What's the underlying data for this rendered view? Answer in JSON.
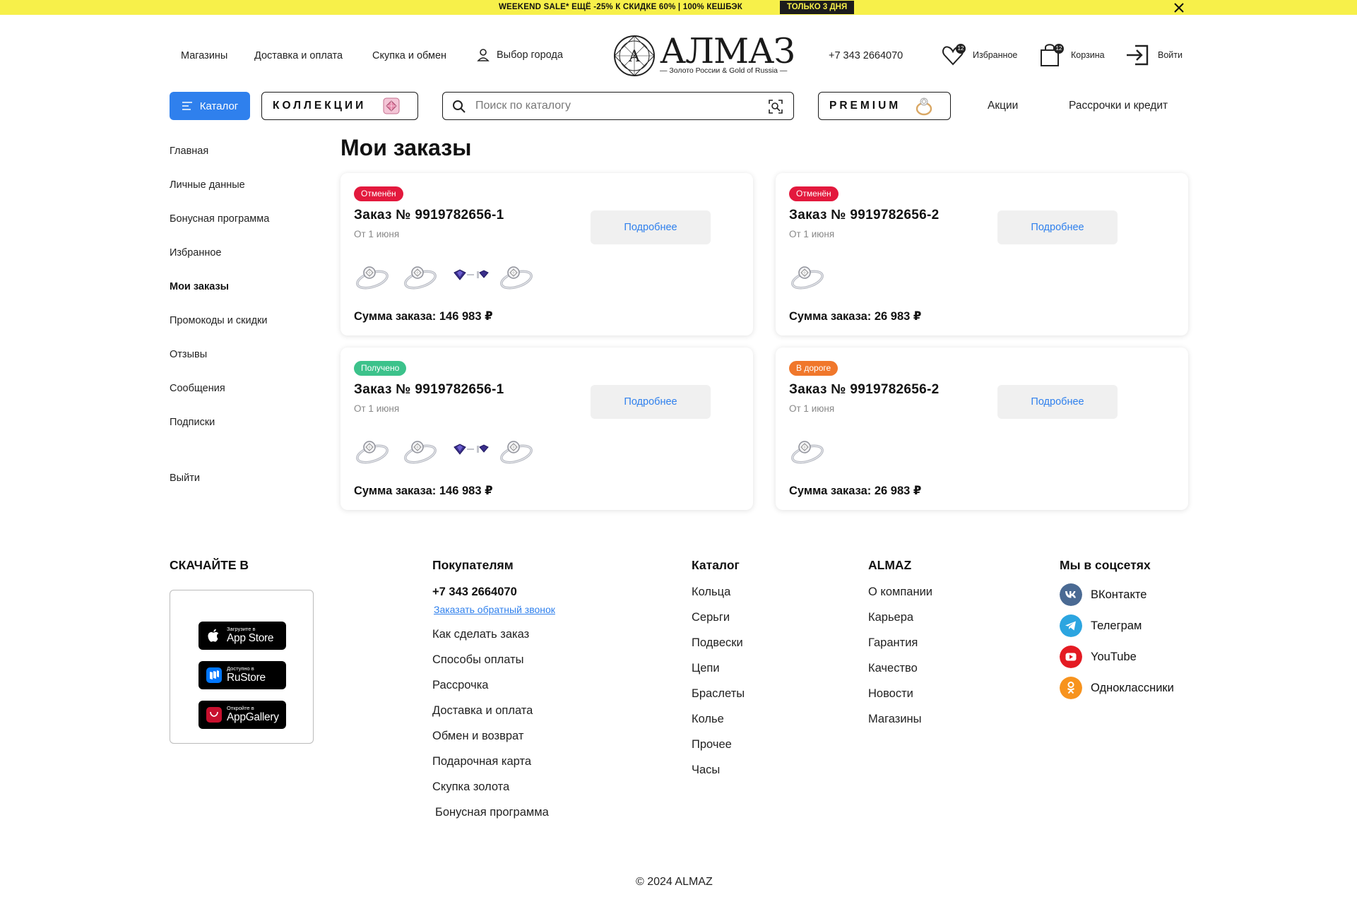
{
  "promo": {
    "text": "WEEKEND SALE* ЕЩЁ -25% К СКИДКЕ 60% | 100% КЕШБЭК",
    "badge": "ТОЛЬКО 3 ДНЯ"
  },
  "header": {
    "links": [
      "Магазины",
      "Доставка и оплата",
      "Скупка и обмен"
    ],
    "city": "Выбор города",
    "logo_name": "АЛМАЗ",
    "logo_letter": "A",
    "logo_sub": "— Золото России & Gold of Russia —",
    "phone": "+7 343 2664070",
    "favorites_label": "Избранное",
    "favorites_count": "12",
    "cart_label": "Корзина",
    "cart_count": "12",
    "login_label": "Войти"
  },
  "nav": {
    "catalog": "Каталог",
    "collections": "КОЛЛЕКЦИИ",
    "search_placeholder": "Поиск по каталогу",
    "premium": "PREMIUM",
    "promotions": "Акции",
    "installments": "Рассрочки и кредит"
  },
  "sidebar": {
    "items": [
      "Главная",
      "Личные данные",
      "Бонусная программа",
      "Избранное",
      "Мои заказы",
      "Промокоды и скидки",
      "Отзывы",
      "Сообщения",
      "Подписки"
    ],
    "active": "Мои заказы",
    "logout": "Выйти"
  },
  "page": {
    "title": "Мои заказы"
  },
  "orders": [
    {
      "status": "Отменён",
      "status_color": "#e3193d",
      "number": "Заказ № 9919782656-1",
      "date": "От 1 июня",
      "more": "Подробнее",
      "sum": "Сумма заказа: 146 983 ₽",
      "items": [
        "ring",
        "ring",
        "earrings",
        "ring"
      ]
    },
    {
      "status": "Отменён",
      "status_color": "#e3193d",
      "number": "Заказ № 9919782656-2",
      "date": "От 1 июня",
      "more": "Подробнее",
      "sum": "Сумма заказа: 26 983 ₽",
      "items": [
        "ring"
      ]
    },
    {
      "status": "Получено",
      "status_color": "#3cc28b",
      "number": "Заказ № 9919782656-1",
      "date": "От 1 июня",
      "more": "Подробнее",
      "sum": "Сумма заказа: 146 983 ₽",
      "items": [
        "ring",
        "ring",
        "earrings",
        "ring"
      ]
    },
    {
      "status": "В дороге",
      "status_color": "#f0772b",
      "number": "Заказ № 9919782656-2",
      "date": "От 1 июня",
      "more": "Подробнее",
      "sum": "Сумма заказа: 26 983 ₽",
      "items": [
        "ring"
      ]
    }
  ],
  "footer": {
    "download_title": "СКАЧАЙТЕ В",
    "apps": [
      {
        "small": "Загрузите в",
        "name": "App Store",
        "icon": "apple-icon"
      },
      {
        "small": "Доступно в",
        "name": "RuStore",
        "icon": "rustore-icon"
      },
      {
        "small": "Откройте в",
        "name": "AppGallery",
        "icon": "huawei-icon"
      }
    ],
    "buyers_title": "Покупателям",
    "phone": "+7 343 2664070",
    "callback": "Заказать обратный звонок",
    "buyers_links": [
      "Как сделать заказ",
      "Способы оплаты",
      "Рассрочка",
      "Доставка и оплата",
      "Обмен и возврат",
      "Подарочная карта",
      "Скупка золота",
      "Бонусная программа"
    ],
    "catalog_title": "Каталог",
    "catalog_links": [
      "Кольца",
      "Серьги",
      "Подвески",
      "Цепи",
      "Браслеты",
      "Колье",
      "Прочее",
      "Часы"
    ],
    "almaz_title": "ALMAZ",
    "almaz_links": [
      "О компании",
      "Карьера",
      "Гарантия",
      "Качество",
      "Новости",
      "Магазины"
    ],
    "social_title": "Мы в соцсетях",
    "social": [
      {
        "name": "ВКонтакте",
        "color": "#4a6a93",
        "icon": "vk-icon"
      },
      {
        "name": "Телеграм",
        "color": "#2ca5e0",
        "icon": "telegram-icon"
      },
      {
        "name": "YouTube",
        "color": "#e41b23",
        "icon": "youtube-icon"
      },
      {
        "name": "Одноклассники",
        "color": "#f7931e",
        "icon": "odnoklassniki-icon"
      }
    ],
    "copyright": "© 2024 ALMAZ"
  }
}
